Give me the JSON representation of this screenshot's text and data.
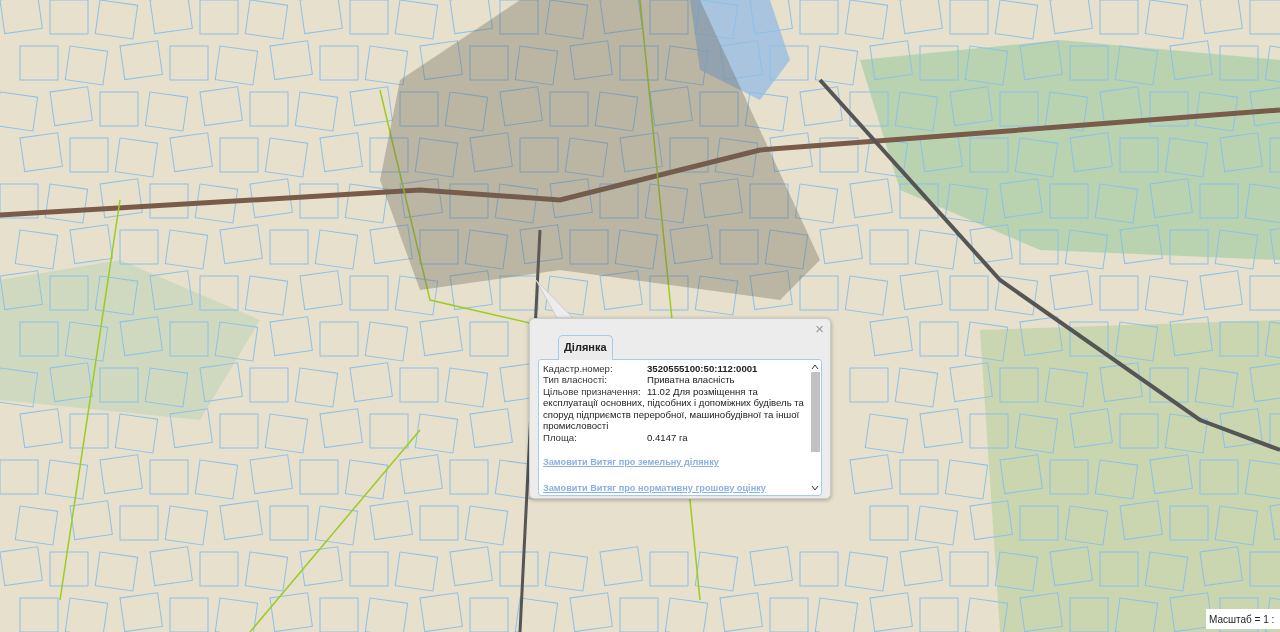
{
  "popup": {
    "close": "×",
    "tabs": [
      {
        "label": "Ділянка",
        "selected": true
      }
    ],
    "fields": [
      {
        "label": "Кадастр.номер:",
        "value": "3520555100:50:112:0001",
        "kind": "bold"
      },
      {
        "label": "Тип власності:",
        "value": "Приватна власність",
        "kind": "plain"
      },
      {
        "label": "Цільове призначення:",
        "value": "11.02 Для розміщення та експлуатації основних, підсобних і допоміжних будівель та споруд підприємств переробної, машинобудівної та іншої промисловості",
        "kind": "plain"
      },
      {
        "label": "Площа:",
        "value": "0.4147 га",
        "kind": "plain"
      }
    ],
    "links": [
      "Замовити Витяг про земельну ділянку",
      "Замовити Витяг про нормативну грошову оцінку"
    ]
  },
  "scale": {
    "text": "Масштаб = 1 :"
  }
}
